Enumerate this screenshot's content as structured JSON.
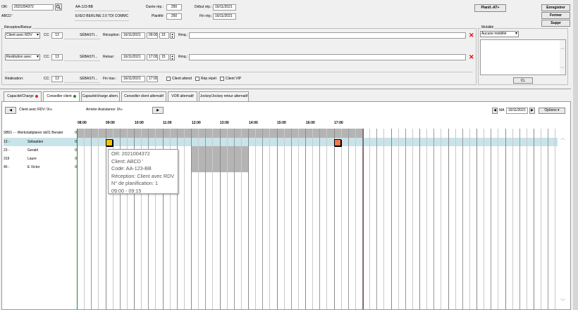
{
  "header": {
    "or_label": "OR:",
    "or_value": "2021004372",
    "plate_value": "AA-123-BB",
    "client_value": "ABCD '",
    "vehicle_value": "EXEO BERLINE 2.0 TDI COMMC",
    "duree_label": "Durée rép.:",
    "duree_value": "250",
    "planifie_label": "Planifié:",
    "planifie_value": "250",
    "debut_label": "Début rép.:",
    "debut_value": "16/11/2021",
    "fin_label": "Fin rép.:",
    "fin_value": "16/11/2021",
    "planif_button": "Planif.-AT+",
    "enregistrer_button": "Enregistrer",
    "fermer_button": "Fermer",
    "suppr_button": "Suppr"
  },
  "reception": {
    "group_label": "Réception/Retour",
    "row1_select": "Client avec RDV",
    "cc_label": "CC:",
    "row1_cc": "13",
    "row1_name": "SÉBASTI...",
    "row1_type_label": "Réception:",
    "row1_date": "16/11/2021",
    "row1_time": "09:00",
    "row1_duration": "15",
    "rmq_label": "Rmq.:",
    "row2_select": "Restitution avec",
    "row2_cc": "13",
    "row2_name": "SÉBASTI...",
    "row2_type_label": "Retour:",
    "row2_date": "16/11/2021",
    "row2_time": "17:00",
    "row2_duration": "15",
    "realisation_label": "Réalisation:",
    "row3_cc": "13",
    "row3_name": "SÉBASTI...",
    "row3_type_label": "Fin trav.:",
    "row3_date": "16/11/2021",
    "row3_time": "17:00",
    "client_attend": "Client attend",
    "rep_repet": "Rép répét",
    "client_vip": "Client VIP"
  },
  "mobilite": {
    "group_label": "Mobilité",
    "select_value": "Aucune mobilité",
    "cl_button": "CL"
  },
  "tabs": [
    {
      "label": "Capacité/Charge",
      "dot": "#e0262a"
    },
    {
      "label": "Conseiller client",
      "dot": "#1f8a2a"
    },
    {
      "label": "Capacité/charge altern."
    },
    {
      "label": "Conseiller client alternatif"
    },
    {
      "label": "VOR alternatif"
    },
    {
      "label": "Jockey/Jockey retour alternatif"
    }
  ],
  "planning": {
    "client_rdv_label": "Client avec RDV: 0/∞",
    "arrivee_label": "Arrivée Assistance: 0/∞",
    "day_label": "MA",
    "date_value": "16/11/2021",
    "options_button": "Options",
    "hours": [
      "08:00",
      "09:00",
      "10:00",
      "11:00",
      "12:00",
      "13:00",
      "14:00",
      "15:00",
      "16:00",
      "17:00"
    ],
    "resources": [
      {
        "code": "SB01 - - Werkstattplaner",
        "name": "sb01 Berater",
        "count": "0"
      },
      {
        "code": "13 -",
        "name": "Sébastien",
        "count": "0"
      },
      {
        "code": "23 -",
        "name": "Gerald",
        "count": "0"
      },
      {
        "code": "319",
        "name": "Laure",
        "count": "0"
      },
      {
        "code": "45 -",
        "name": "E Victor",
        "count": "0"
      }
    ],
    "tooltip": {
      "line1": "OR: 2021004372",
      "line2": "Client: ABCD '",
      "line3": "Code: AA-123-BB",
      "line4": "Réception: Client avec RDV",
      "line5": "N° de planification: 1",
      "line6": "09:00 - 09:15"
    }
  },
  "colors": {
    "accent_green": "#1f8a2a",
    "now_line": "#e0262a",
    "selected_row": "#c9e3ea",
    "busy_gray": "#b4b4b4",
    "appointment_yellow": "#f4c20d",
    "appointment_orange": "#f07a4a"
  }
}
